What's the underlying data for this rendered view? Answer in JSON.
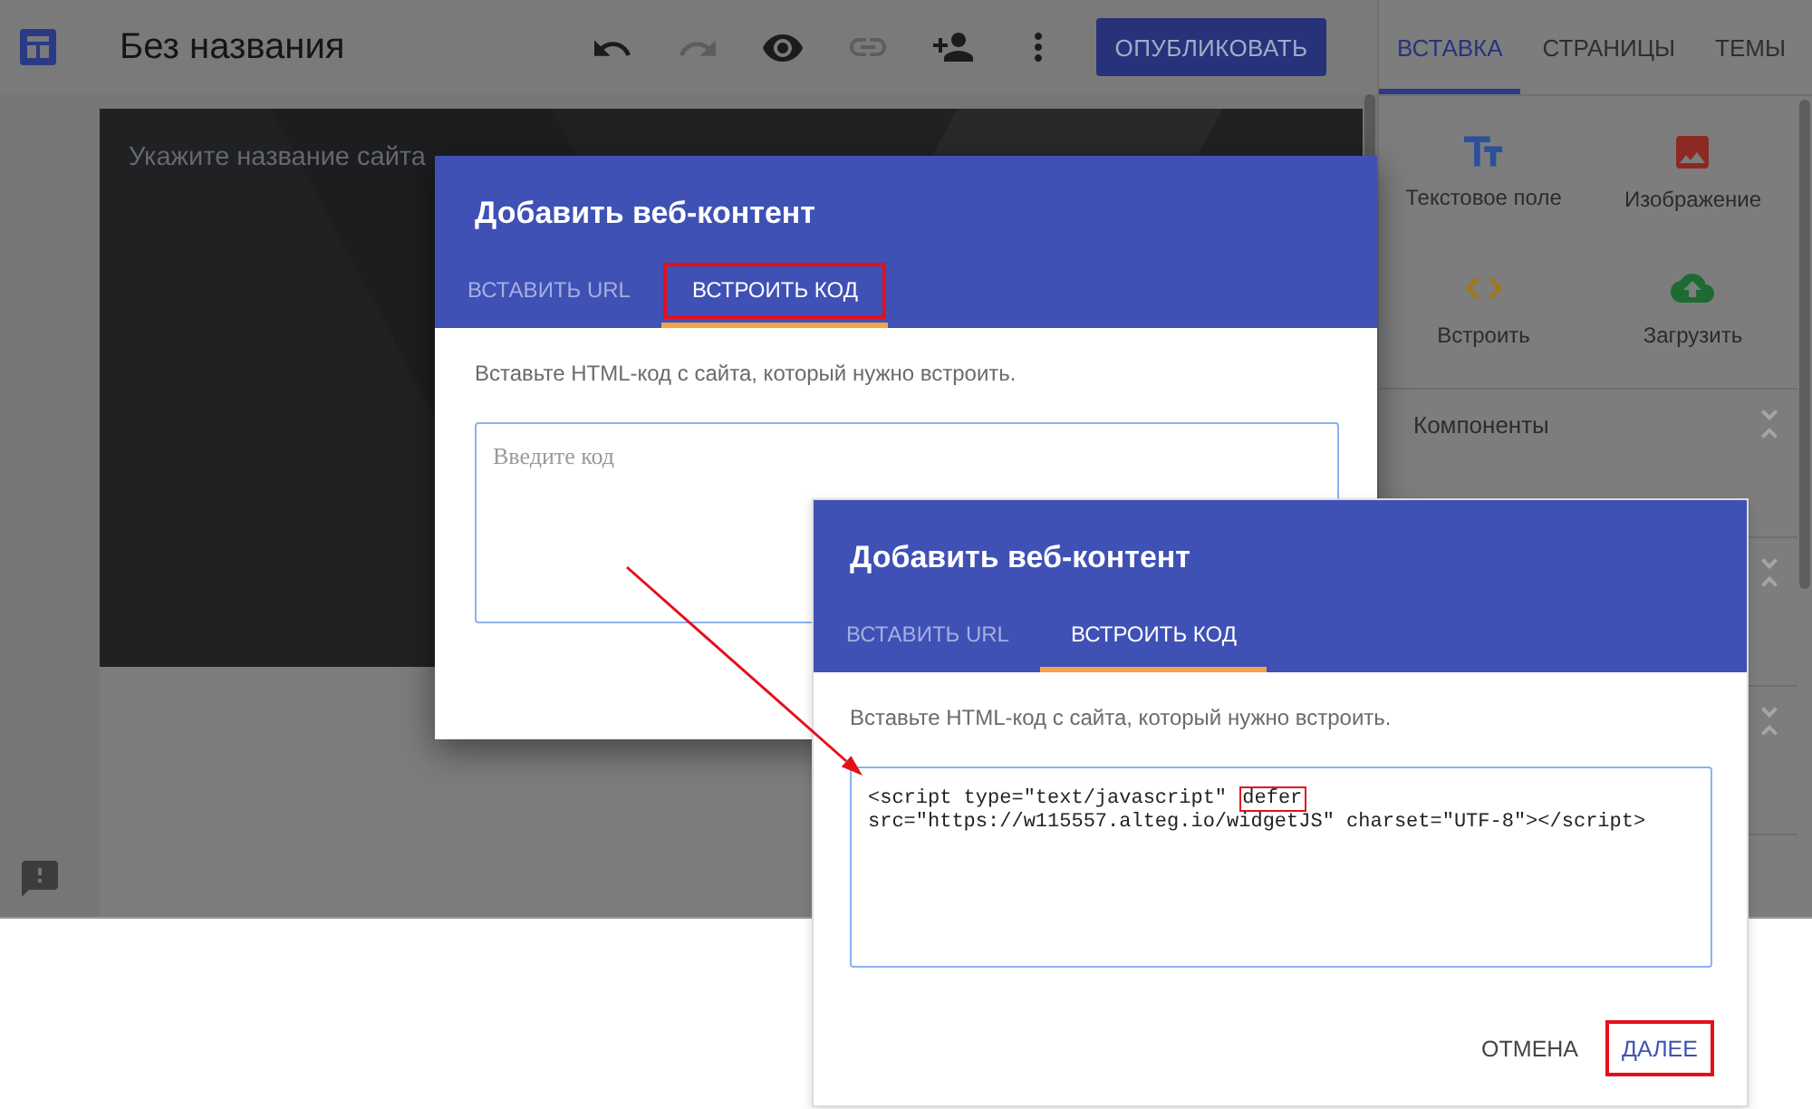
{
  "editor": {
    "title": "Без названия",
    "toolbar": [
      {
        "kind": "undo",
        "disabled": false
      },
      {
        "kind": "redo",
        "disabled": true
      },
      {
        "kind": "preview",
        "disabled": false
      },
      {
        "kind": "link",
        "disabled": true
      },
      {
        "kind": "share",
        "disabled": false
      },
      {
        "kind": "more",
        "disabled": false
      }
    ],
    "publish_button": "ОПУБЛИКОВАТЬ"
  },
  "canvas": {
    "site_name": {
      "placeholder": "Укажите название сайта"
    }
  },
  "insert_panel": {
    "tabs": [
      {
        "label": "ВСТАВКА",
        "selected": true
      },
      {
        "label": "СТРАНИЦЫ",
        "selected": false
      },
      {
        "label": "ТЕМЫ",
        "selected": false
      }
    ],
    "items": [
      {
        "kind": "text",
        "label": "Текстовое поле"
      },
      {
        "kind": "image",
        "label": "Изображение"
      },
      {
        "kind": "embed",
        "label": "Встроить"
      },
      {
        "kind": "upload",
        "label": "Загрузить"
      }
    ],
    "sections": [
      {
        "title": "Компоненты",
        "expanded": true
      },
      {
        "expanded": true
      },
      {
        "expanded": true
      }
    ]
  },
  "dialog": {
    "title": "Добавить веб-контент",
    "tabs": [
      {
        "label": "ВСТАВИТЬ URL",
        "selected": false,
        "highlighted": false
      },
      {
        "label": "ВСТРОИТЬ КОД",
        "selected": true,
        "highlighted": true
      }
    ],
    "hint": "Вставьте HTML-код с сайта, который нужно встроить.",
    "code": {
      "placeholder": "Введите код"
    }
  },
  "dialog_zoomed": {
    "title": "Добавить веб-контент",
    "tabs": [
      {
        "label": "ВСТАВИТЬ URL",
        "selected": false,
        "highlighted": false
      },
      {
        "label": "ВСТРОИТЬ КОД",
        "selected": true,
        "highlighted": false
      }
    ],
    "hint": "Вставьте HTML-код с сайта, который нужно встроить.",
    "code": {
      "lines": [
        [
          {
            "text": "<script type=\"text/javascript\" ",
            "highlighted": false
          },
          {
            "text": "defer",
            "highlighted": true
          }
        ],
        [
          {
            "text": "src=\"https://w115557.alteg.io/widgetJS\" charset=\"UTF-8\"></script>",
            "highlighted": false
          }
        ]
      ]
    },
    "buttons": [
      {
        "kind": "text",
        "label": "ОТМЕНА",
        "highlighted": false
      },
      {
        "kind": "primary",
        "label": "ДАЛЕЕ",
        "highlighted": true
      }
    ]
  },
  "callout_arrow": true
}
